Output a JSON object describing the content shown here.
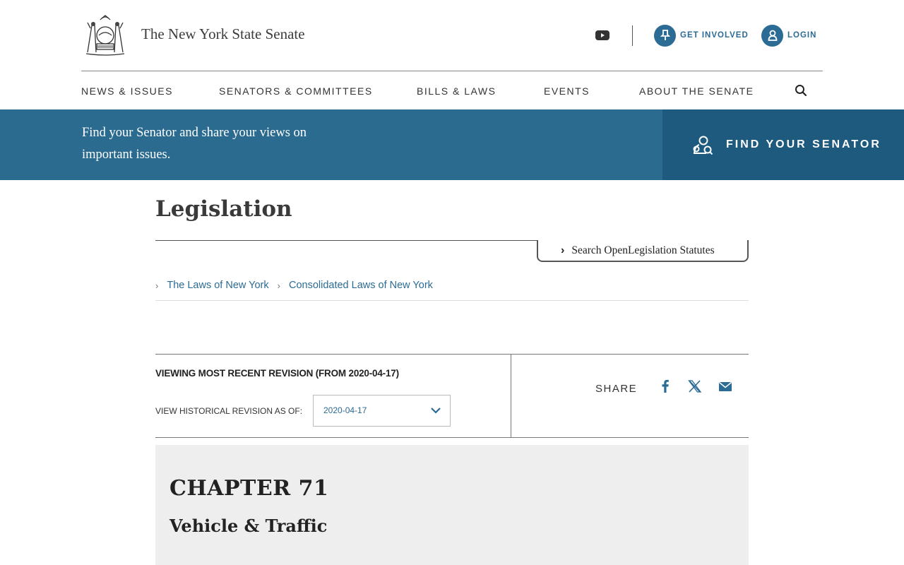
{
  "header": {
    "site_title": "The New York State Senate",
    "get_involved_label": "GET INVOLVED",
    "login_label": "LOGIN"
  },
  "nav": {
    "items": [
      {
        "label": "NEWS & ISSUES"
      },
      {
        "label": "SENATORS & COMMITTEES"
      },
      {
        "label": "BILLS & LAWS"
      },
      {
        "label": "EVENTS"
      },
      {
        "label": "ABOUT THE SENATE"
      }
    ]
  },
  "banner": {
    "text": "Find your Senator and share your views on important issues.",
    "cta_label": "FIND YOUR SENATOR"
  },
  "legislation": {
    "title": "Legislation",
    "search_label": "Search OpenLegislation Statutes",
    "breadcrumbs": [
      {
        "label": "The Laws of New York"
      },
      {
        "label": "Consolidated Laws of New York"
      }
    ]
  },
  "revision": {
    "title": "VIEWING MOST RECENT REVISION (FROM 2020-04-17)",
    "historical_label": "VIEW HISTORICAL REVISION AS OF:",
    "selected_date": "2020-04-17",
    "share_label": "SHARE"
  },
  "chapter": {
    "number": "CHAPTER 71",
    "name": "Vehicle & Traffic"
  },
  "colors": {
    "brand_blue": "#2b6b94",
    "banner_blue": "#2b6b8f",
    "cta_blue": "#1d5a7e",
    "chapter_bg": "#eeeeee"
  }
}
